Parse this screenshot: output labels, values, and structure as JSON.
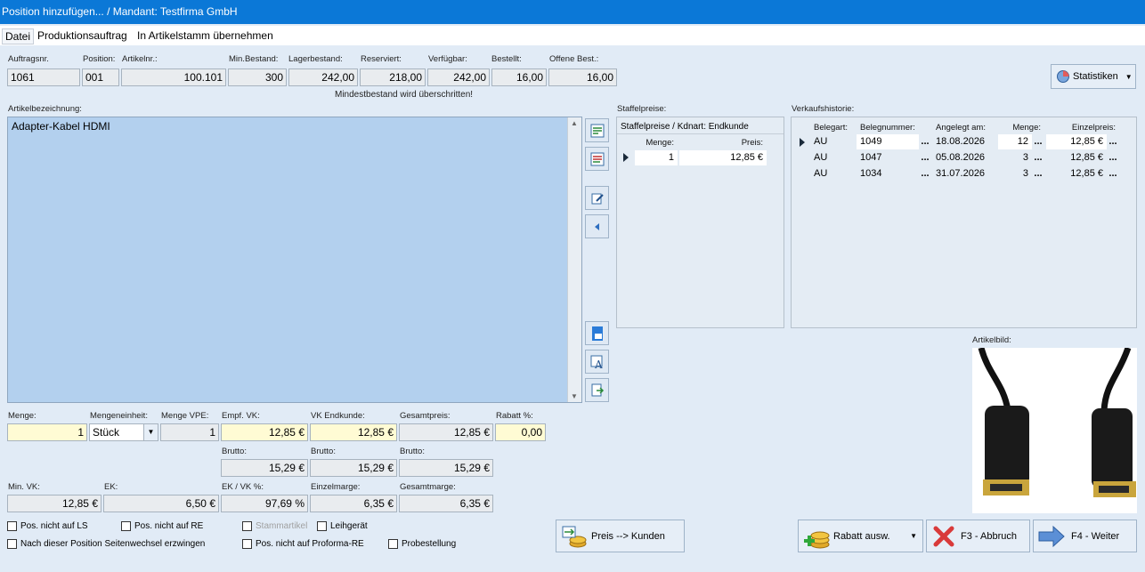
{
  "window": {
    "title": "Position hinzufügen... / Mandant: Testfirma GmbH"
  },
  "menu": {
    "items": [
      "Datei",
      "Produktionsauftrag",
      "In Artikelstamm übernehmen"
    ]
  },
  "top": {
    "labels": {
      "auftragsnr": "Auftragsnr.",
      "position": "Position:",
      "artikelnr": "Artikelnr.:",
      "minbestand": "Min.Bestand:",
      "lagerbestand": "Lagerbestand:",
      "reserviert": "Reserviert:",
      "verfuegbar": "Verfügbar:",
      "bestellt": "Bestellt:",
      "offene": "Offene Best.:"
    },
    "values": {
      "auftragsnr": "1061",
      "position": "001",
      "artikelnr": "100.101",
      "minbestand": "300",
      "lagerbestand": "242,00",
      "reserviert": "218,00",
      "verfuegbar": "242,00",
      "bestellt": "16,00",
      "offene": "16,00"
    },
    "warning": "Mindestbestand wird überschritten!",
    "statistiken_label": "Statistiken"
  },
  "article": {
    "label": "Artikelbezeichnung:",
    "text": "Adapter-Kabel HDMI"
  },
  "staffel": {
    "section_label": "Staffelpreise:",
    "title": "Staffelpreise / Kdnart: Endkunde",
    "headers": [
      "Menge:",
      "Preis:"
    ],
    "rows": [
      [
        "1",
        "12,85 €"
      ]
    ]
  },
  "historie": {
    "section_label": "Verkaufshistorie:",
    "headers": [
      "Belegart:",
      "Belegnummer:",
      "Angelegt am:",
      "Menge:",
      "Einzelpreis:"
    ],
    "more_label": "...",
    "rows": [
      [
        "AU",
        "1049",
        "18.08.2026",
        "12",
        "12,85 €"
      ],
      [
        "AU",
        "1047",
        "05.08.2026",
        "3",
        "12,85 €"
      ],
      [
        "AU",
        "1034",
        "31.07.2026",
        "3",
        "12,85 €"
      ]
    ]
  },
  "artikelbild_label": "Artikelbild:",
  "pricing": {
    "labels": {
      "menge": "Menge:",
      "mengeneinheit": "Mengeneinheit:",
      "menge_vpe": "Menge VPE:",
      "empf_vk": "Empf. VK:",
      "vk_endkunde": "VK Endkunde:",
      "gesamtpreis": "Gesamtpreis:",
      "rabatt": "Rabatt %:",
      "brutto": "Brutto:",
      "min_vk": "Min. VK:",
      "ek": "EK:",
      "ek_vk": "EK / VK %:",
      "einzelmarge": "Einzelmarge:",
      "gesamtmarge": "Gesamtmarge:"
    },
    "values": {
      "menge": "1",
      "mengeneinheit": "Stück",
      "menge_vpe": "1",
      "empf_vk": "12,85 €",
      "vk_endkunde": "12,85 €",
      "gesamtpreis": "12,85 €",
      "rabatt": "0,00",
      "brutto_empf": "15,29 €",
      "brutto_vk": "15,29 €",
      "brutto_gesamt": "15,29 €",
      "min_vk": "12,85 €",
      "ek": "6,50 €",
      "ek_vk": "97,69 %",
      "einzelmarge": "6,35 €",
      "gesamtmarge": "6,35 €"
    }
  },
  "checkboxes": {
    "pos_ls": "Pos. nicht auf LS",
    "pos_re": "Pos. nicht auf RE",
    "stammartikel": "Stammartikel",
    "leihgeraet": "Leihgerät",
    "seitenwechsel": "Nach dieser Position Seitenwechsel erzwingen",
    "proforma": "Pos. nicht auf Proforma-RE",
    "probestellung": "Probestellung"
  },
  "buttons": {
    "preis_kunden": "Preis --> Kunden",
    "rabatt": "Rabatt ausw.",
    "abbruch": "F3 - Abbruch",
    "weiter": "F4 - Weiter"
  },
  "colors": {
    "titlebar": "#0b78d7",
    "background": "#e1ebf6",
    "memo": "#b3d0ee",
    "highlight_field": "#fffbd4"
  }
}
